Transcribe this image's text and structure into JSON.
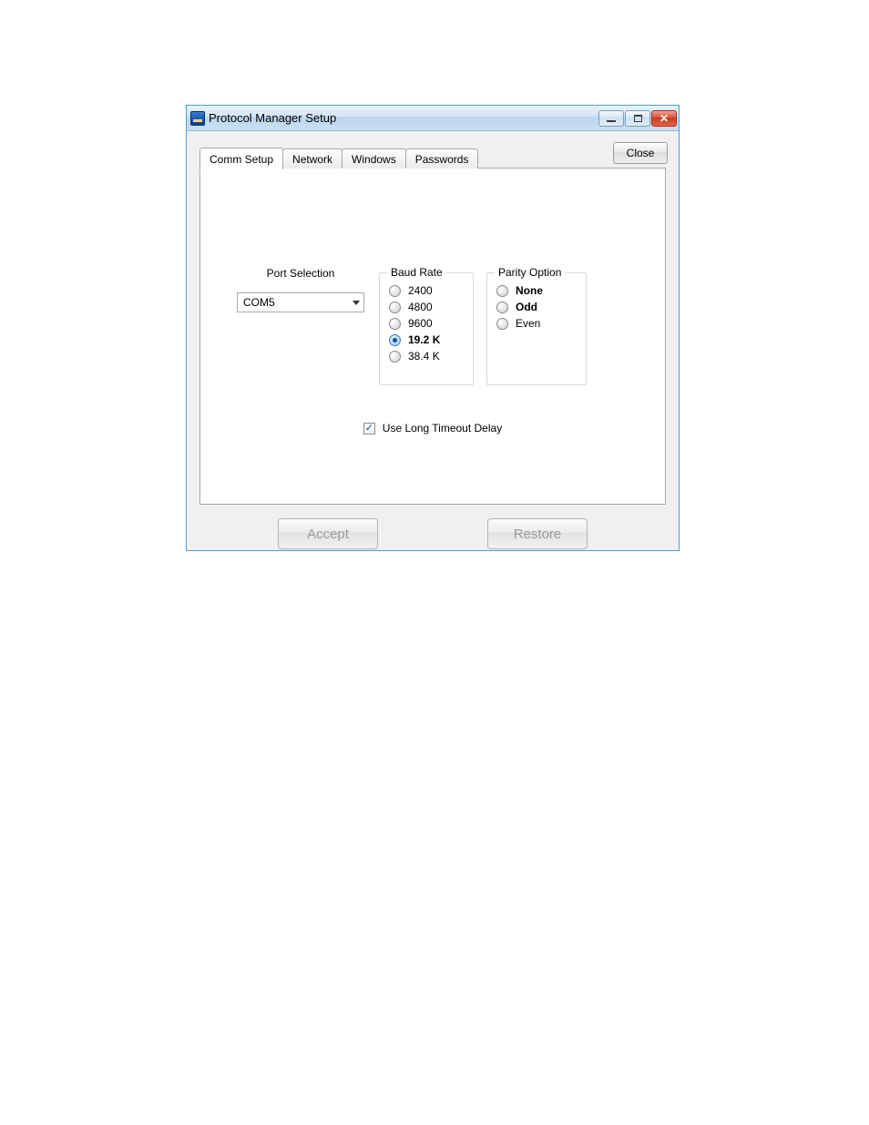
{
  "window": {
    "title": "Protocol Manager Setup"
  },
  "header": {
    "close_label": "Close"
  },
  "tabs": [
    {
      "label": "Comm Setup",
      "active": true
    },
    {
      "label": "Network",
      "active": false
    },
    {
      "label": "Windows",
      "active": false
    },
    {
      "label": "Passwords",
      "active": false
    }
  ],
  "port": {
    "label": "Port Selection",
    "value": "COM5"
  },
  "baud": {
    "title": "Baud Rate",
    "options": [
      {
        "label": "2400",
        "checked": false,
        "bold": false
      },
      {
        "label": "4800",
        "checked": false,
        "bold": false
      },
      {
        "label": "9600",
        "checked": false,
        "bold": false
      },
      {
        "label": "19.2 K",
        "checked": true,
        "bold": true
      },
      {
        "label": "38.4 K",
        "checked": false,
        "bold": false
      }
    ]
  },
  "parity": {
    "title": "Parity Option",
    "options": [
      {
        "label": "None",
        "checked": false,
        "bold": true
      },
      {
        "label": "Odd",
        "checked": false,
        "bold": true
      },
      {
        "label": "Even",
        "checked": false,
        "bold": false
      }
    ]
  },
  "timeout": {
    "label": "Use Long Timeout Delay",
    "checked": true
  },
  "buttons": {
    "accept": "Accept",
    "restore": "Restore"
  }
}
